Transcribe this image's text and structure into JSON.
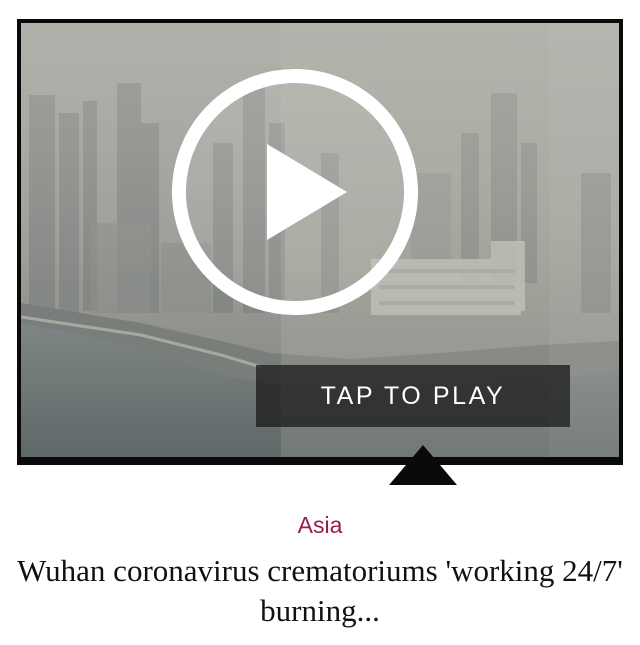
{
  "video": {
    "play_icon": "play-icon",
    "tap_label": "TAP TO PLAY"
  },
  "article": {
    "category": "Asia",
    "headline": "Wuhan coronavirus crematoriums 'working 24/7' burning..."
  },
  "colors": {
    "category": "#9b1a52",
    "banner_bg": "#1e1e1e",
    "frame": "#0a0a0a"
  }
}
